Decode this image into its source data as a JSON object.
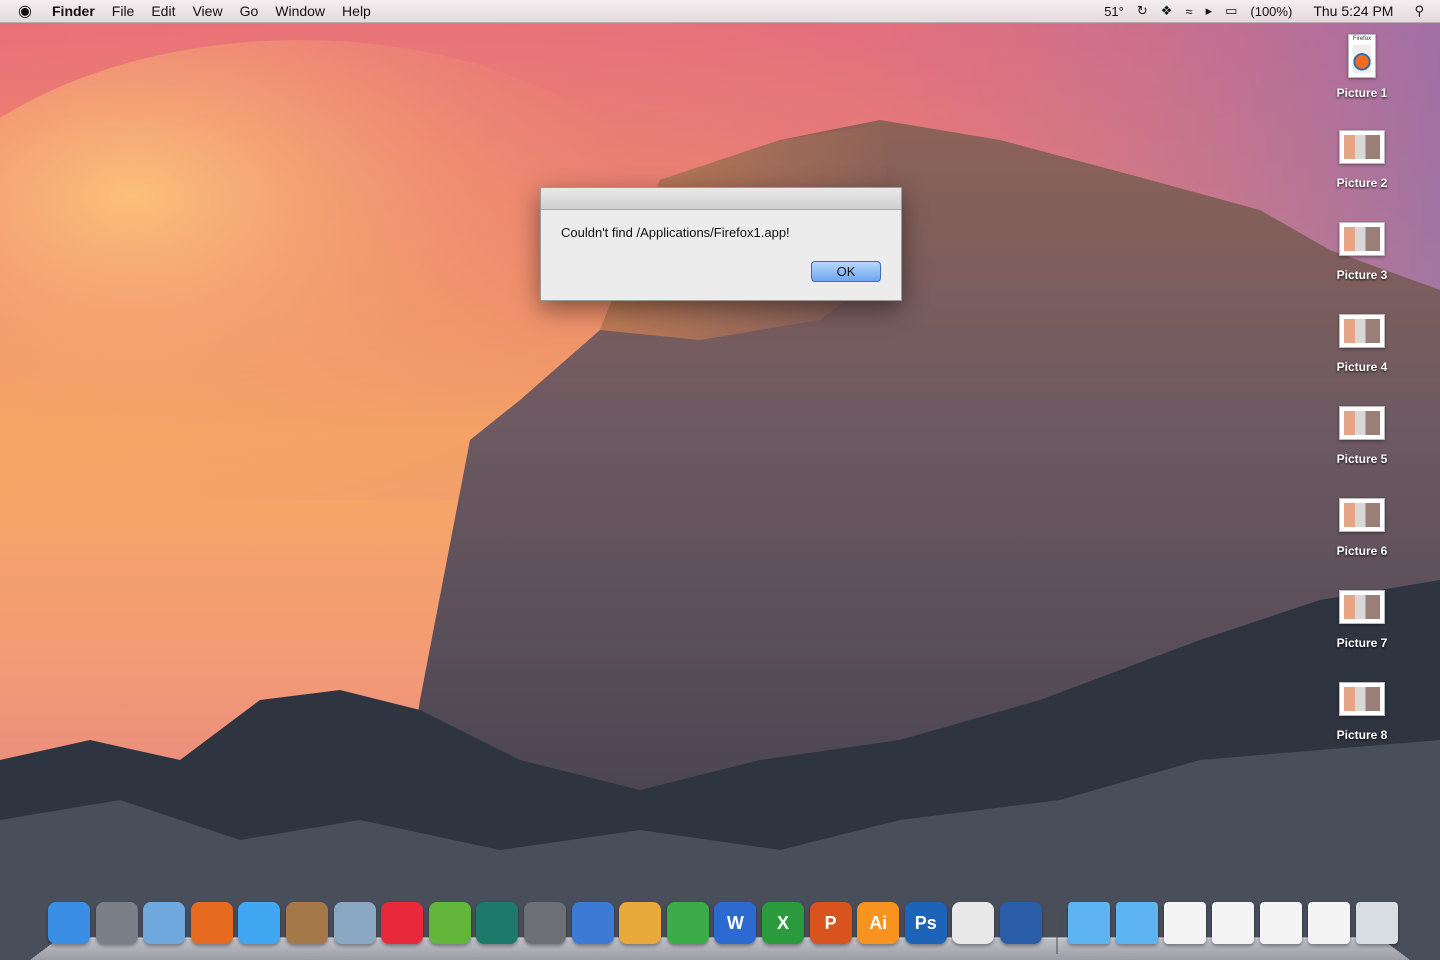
{
  "menubar": {
    "app": "Finder",
    "menus": [
      "File",
      "Edit",
      "View",
      "Go",
      "Window",
      "Help"
    ],
    "status": {
      "temperature": "51°",
      "battery": "(100%)",
      "clock": "Thu 5:24 PM"
    }
  },
  "dialog": {
    "message": "Couldn't find /Applications/Firefox1.app!",
    "ok_label": "OK"
  },
  "desktop_icons": [
    {
      "label": "Picture 1",
      "thumb_label": "Firefox"
    },
    {
      "label": "Picture 2"
    },
    {
      "label": "Picture 3"
    },
    {
      "label": "Picture 4"
    },
    {
      "label": "Picture 5"
    },
    {
      "label": "Picture 6"
    },
    {
      "label": "Picture 7"
    },
    {
      "label": "Picture 8"
    }
  ],
  "dock": {
    "apps": [
      {
        "icon": "finder-icon",
        "text": "",
        "color": "#3a8ee6"
      },
      {
        "icon": "launchpad-icon",
        "text": "",
        "color": "#7a7f88"
      },
      {
        "icon": "mail-icon",
        "text": "",
        "color": "#6fa8dc"
      },
      {
        "icon": "firefox-icon",
        "text": "",
        "color": "#e66a1f"
      },
      {
        "icon": "messages-icon",
        "text": "",
        "color": "#41a7f2"
      },
      {
        "icon": "contacts-icon",
        "text": "",
        "color": "#a5784a"
      },
      {
        "icon": "preview-icon",
        "text": "",
        "color": "#8aa8c4"
      },
      {
        "icon": "itunes-icon",
        "text": "",
        "color": "#e8283b"
      },
      {
        "icon": "spotify-icon",
        "text": "",
        "color": "#62b63a"
      },
      {
        "icon": "time-machine-icon",
        "text": "",
        "color": "#1d7a6b"
      },
      {
        "icon": "system-preferences-icon",
        "text": "",
        "color": "#6c6f74"
      },
      {
        "icon": "keynote-icon",
        "text": "",
        "color": "#3d7ad6"
      },
      {
        "icon": "pages-icon",
        "text": "",
        "color": "#e9a93a"
      },
      {
        "icon": "numbers-icon",
        "text": "",
        "color": "#3cab49"
      },
      {
        "icon": "word-icon",
        "text": "W",
        "color": "#2c6ad1"
      },
      {
        "icon": "excel-icon",
        "text": "X",
        "color": "#2b9a3c"
      },
      {
        "icon": "powerpoint-icon",
        "text": "P",
        "color": "#d9531e"
      },
      {
        "icon": "illustrator-icon",
        "text": "Ai",
        "color": "#f7931e"
      },
      {
        "icon": "photoshop-icon",
        "text": "Ps",
        "color": "#1d63b8"
      },
      {
        "icon": "textedit-icon",
        "text": "",
        "color": "#e8e8e8"
      },
      {
        "icon": "network-icon",
        "text": "",
        "color": "#2a5ea8"
      }
    ],
    "stack_items": [
      {
        "icon": "applications-folder-icon",
        "color": "#5eb4f0"
      },
      {
        "icon": "downloads-folder-icon",
        "color": "#5eb4f0"
      },
      {
        "icon": "document-stack-icon",
        "color": "#f4f4f4"
      },
      {
        "icon": "screenshot-stack-icon",
        "color": "#f4f4f4"
      },
      {
        "icon": "screenshot-stack-icon",
        "color": "#f4f4f4"
      },
      {
        "icon": "screenshot-stack-icon",
        "color": "#f4f4f4"
      },
      {
        "icon": "trash-icon",
        "color": "#d8dde2"
      }
    ]
  }
}
